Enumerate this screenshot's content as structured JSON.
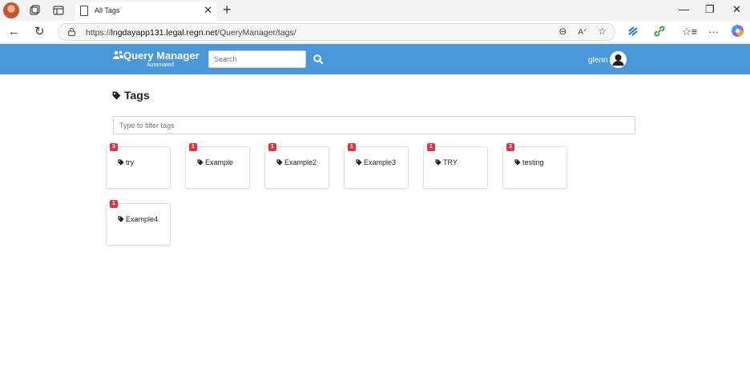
{
  "browser": {
    "tab_title": "All Tags",
    "url_prefix": "https://",
    "url_host": "lngdayapp131.legal.regn.net",
    "url_path": "/QueryManager/tags/"
  },
  "app": {
    "brand_name": "Query Manager",
    "brand_sub": "Automated",
    "search_placeholder": "Search",
    "user_name": "glenn",
    "accent_color": "#4a98d9"
  },
  "page": {
    "title": "Tags",
    "filter_placeholder": "Type to filter tags",
    "badge_color": "#dc3545",
    "tags": [
      {
        "name": "try",
        "count": "3"
      },
      {
        "name": "Example",
        "count": "1"
      },
      {
        "name": "Example2",
        "count": "1"
      },
      {
        "name": "Example3",
        "count": "1"
      },
      {
        "name": "TRY",
        "count": "1"
      },
      {
        "name": "testing",
        "count": "3"
      },
      {
        "name": "Example4",
        "count": "1"
      }
    ]
  }
}
